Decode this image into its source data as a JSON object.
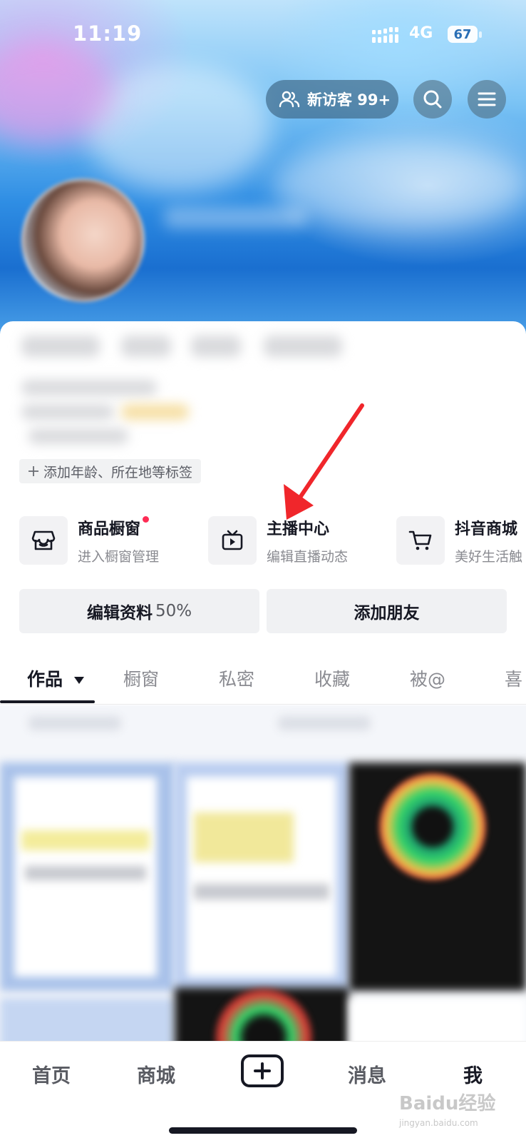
{
  "status_bar": {
    "time": "11:19",
    "network": "4G",
    "battery": "67"
  },
  "header": {
    "visitors_label": "新访客 99+",
    "icons": [
      "visitors-icon",
      "search-icon",
      "menu-icon"
    ]
  },
  "profile": {
    "tags_label": "添加年龄、所在地等标签"
  },
  "features": [
    {
      "title": "商品橱窗",
      "subtitle": "进入橱窗管理",
      "icon": "storefront-icon",
      "has_badge": true
    },
    {
      "title": "主播中心",
      "subtitle": "编辑直播动态",
      "icon": "tv-icon",
      "has_badge": false
    },
    {
      "title": "抖音商城",
      "subtitle": "美好生活触",
      "icon": "cart-icon",
      "has_badge": false
    }
  ],
  "actions": {
    "edit_profile_label": "编辑资料",
    "edit_profile_progress": "50%",
    "add_friends_label": "添加朋友"
  },
  "tabs": [
    {
      "label": "作品",
      "active": true
    },
    {
      "label": "橱窗"
    },
    {
      "label": "私密"
    },
    {
      "label": "收藏"
    },
    {
      "label": "被@"
    },
    {
      "label": "喜"
    }
  ],
  "bottom_nav": {
    "home": "首页",
    "mall": "商城",
    "messages": "消息",
    "me": "我"
  },
  "watermark": {
    "brand": "Baidu经验",
    "url": "jingyan.baidu.com"
  },
  "colors": {
    "accent_red": "#fe2c55",
    "annotation_arrow": "#f0262b",
    "text_primary": "#161823"
  }
}
